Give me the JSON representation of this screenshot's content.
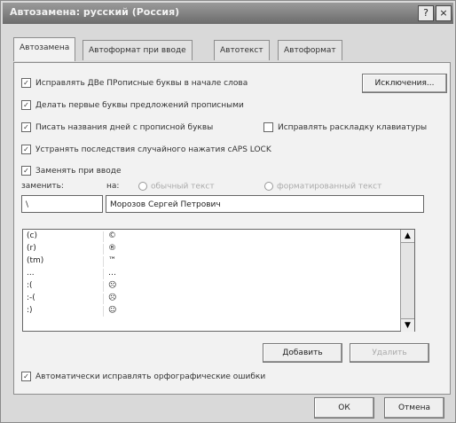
{
  "window": {
    "title": "Автозамена: русский (Россия)",
    "help_label": "?",
    "close_label": "×"
  },
  "tabs": [
    "Автозамена",
    "Автоформат при вводе",
    "Автотекст",
    "Автоформат"
  ],
  "options": {
    "correct_two_initial_caps": "Исправлять ДВе ПРописные буквы в начале слова",
    "capitalize_first_letter": "Делать первые буквы предложений прописными",
    "capitalize_day_names": "Писать названия дней с прописной буквы",
    "correct_keyboard_layout": "Исправлять раскладку клавиатуры",
    "correct_caps_lock": "Устранять последствия случайного нажатия cAPS LOCK",
    "replace_as_you_type": "Заменять при вводе",
    "auto_spell_correct": "Автоматически исправлять орфографические ошибки"
  },
  "buttons": {
    "exceptions": "Исключения...",
    "add": "Добавить",
    "delete": "Удалить",
    "ok": "ОК",
    "cancel": "Отмена"
  },
  "replace_section": {
    "replace_label": "заменить:",
    "with_label": "на:",
    "plain_text_label": "обычный текст",
    "formatted_text_label": "форматированный текст",
    "replace_value": "\\",
    "with_value": "Морозов Сергей Петрович"
  },
  "list_rows": [
    {
      "key": "(c)",
      "value": "©"
    },
    {
      "key": "(r)",
      "value": "®"
    },
    {
      "key": "(tm)",
      "value": "™"
    },
    {
      "key": "...",
      "value": "…"
    },
    {
      "key": ":(",
      "value": "☹"
    },
    {
      "key": ":-(",
      "value": "☹"
    },
    {
      "key": ":)",
      "value": "☺"
    }
  ],
  "scroll": {
    "up": "▲",
    "down": "▼"
  },
  "check_mark": "✓"
}
